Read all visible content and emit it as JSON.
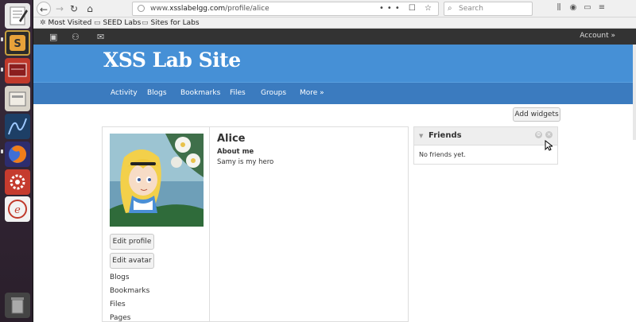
{
  "browser": {
    "url_prefix": "www.",
    "url_domain": "xsslabelgg.com",
    "url_path": "/profile/alice",
    "url_tools": "••• ☐ ☆",
    "search_placeholder": "Search",
    "bookmarks": [
      {
        "label": "Most Visited",
        "icon": "gear-icon"
      },
      {
        "label": "SEED Labs",
        "icon": "folder-icon"
      },
      {
        "label": "Sites for Labs",
        "icon": "folder-icon"
      }
    ]
  },
  "topbar": {
    "account_label": "Account »"
  },
  "site": {
    "title": "XSS Lab Site",
    "menu": [
      "Activity",
      "Blogs",
      "Bookmarks",
      "Files",
      "Groups",
      "More »"
    ],
    "add_widgets_label": "Add widgets"
  },
  "profile": {
    "name": "Alice",
    "about_label": "About me",
    "about_value": "Samy is my hero",
    "edit_profile_label": "Edit profile",
    "edit_avatar_label": "Edit avatar",
    "links": [
      "Blogs",
      "Bookmarks",
      "Files",
      "Pages"
    ]
  },
  "friends_widget": {
    "title": "Friends",
    "body": "No friends yet."
  },
  "colors": {
    "header_blue": "#4690d6",
    "menu_blue": "#3b7bbf",
    "topbar_dark": "#333333"
  }
}
